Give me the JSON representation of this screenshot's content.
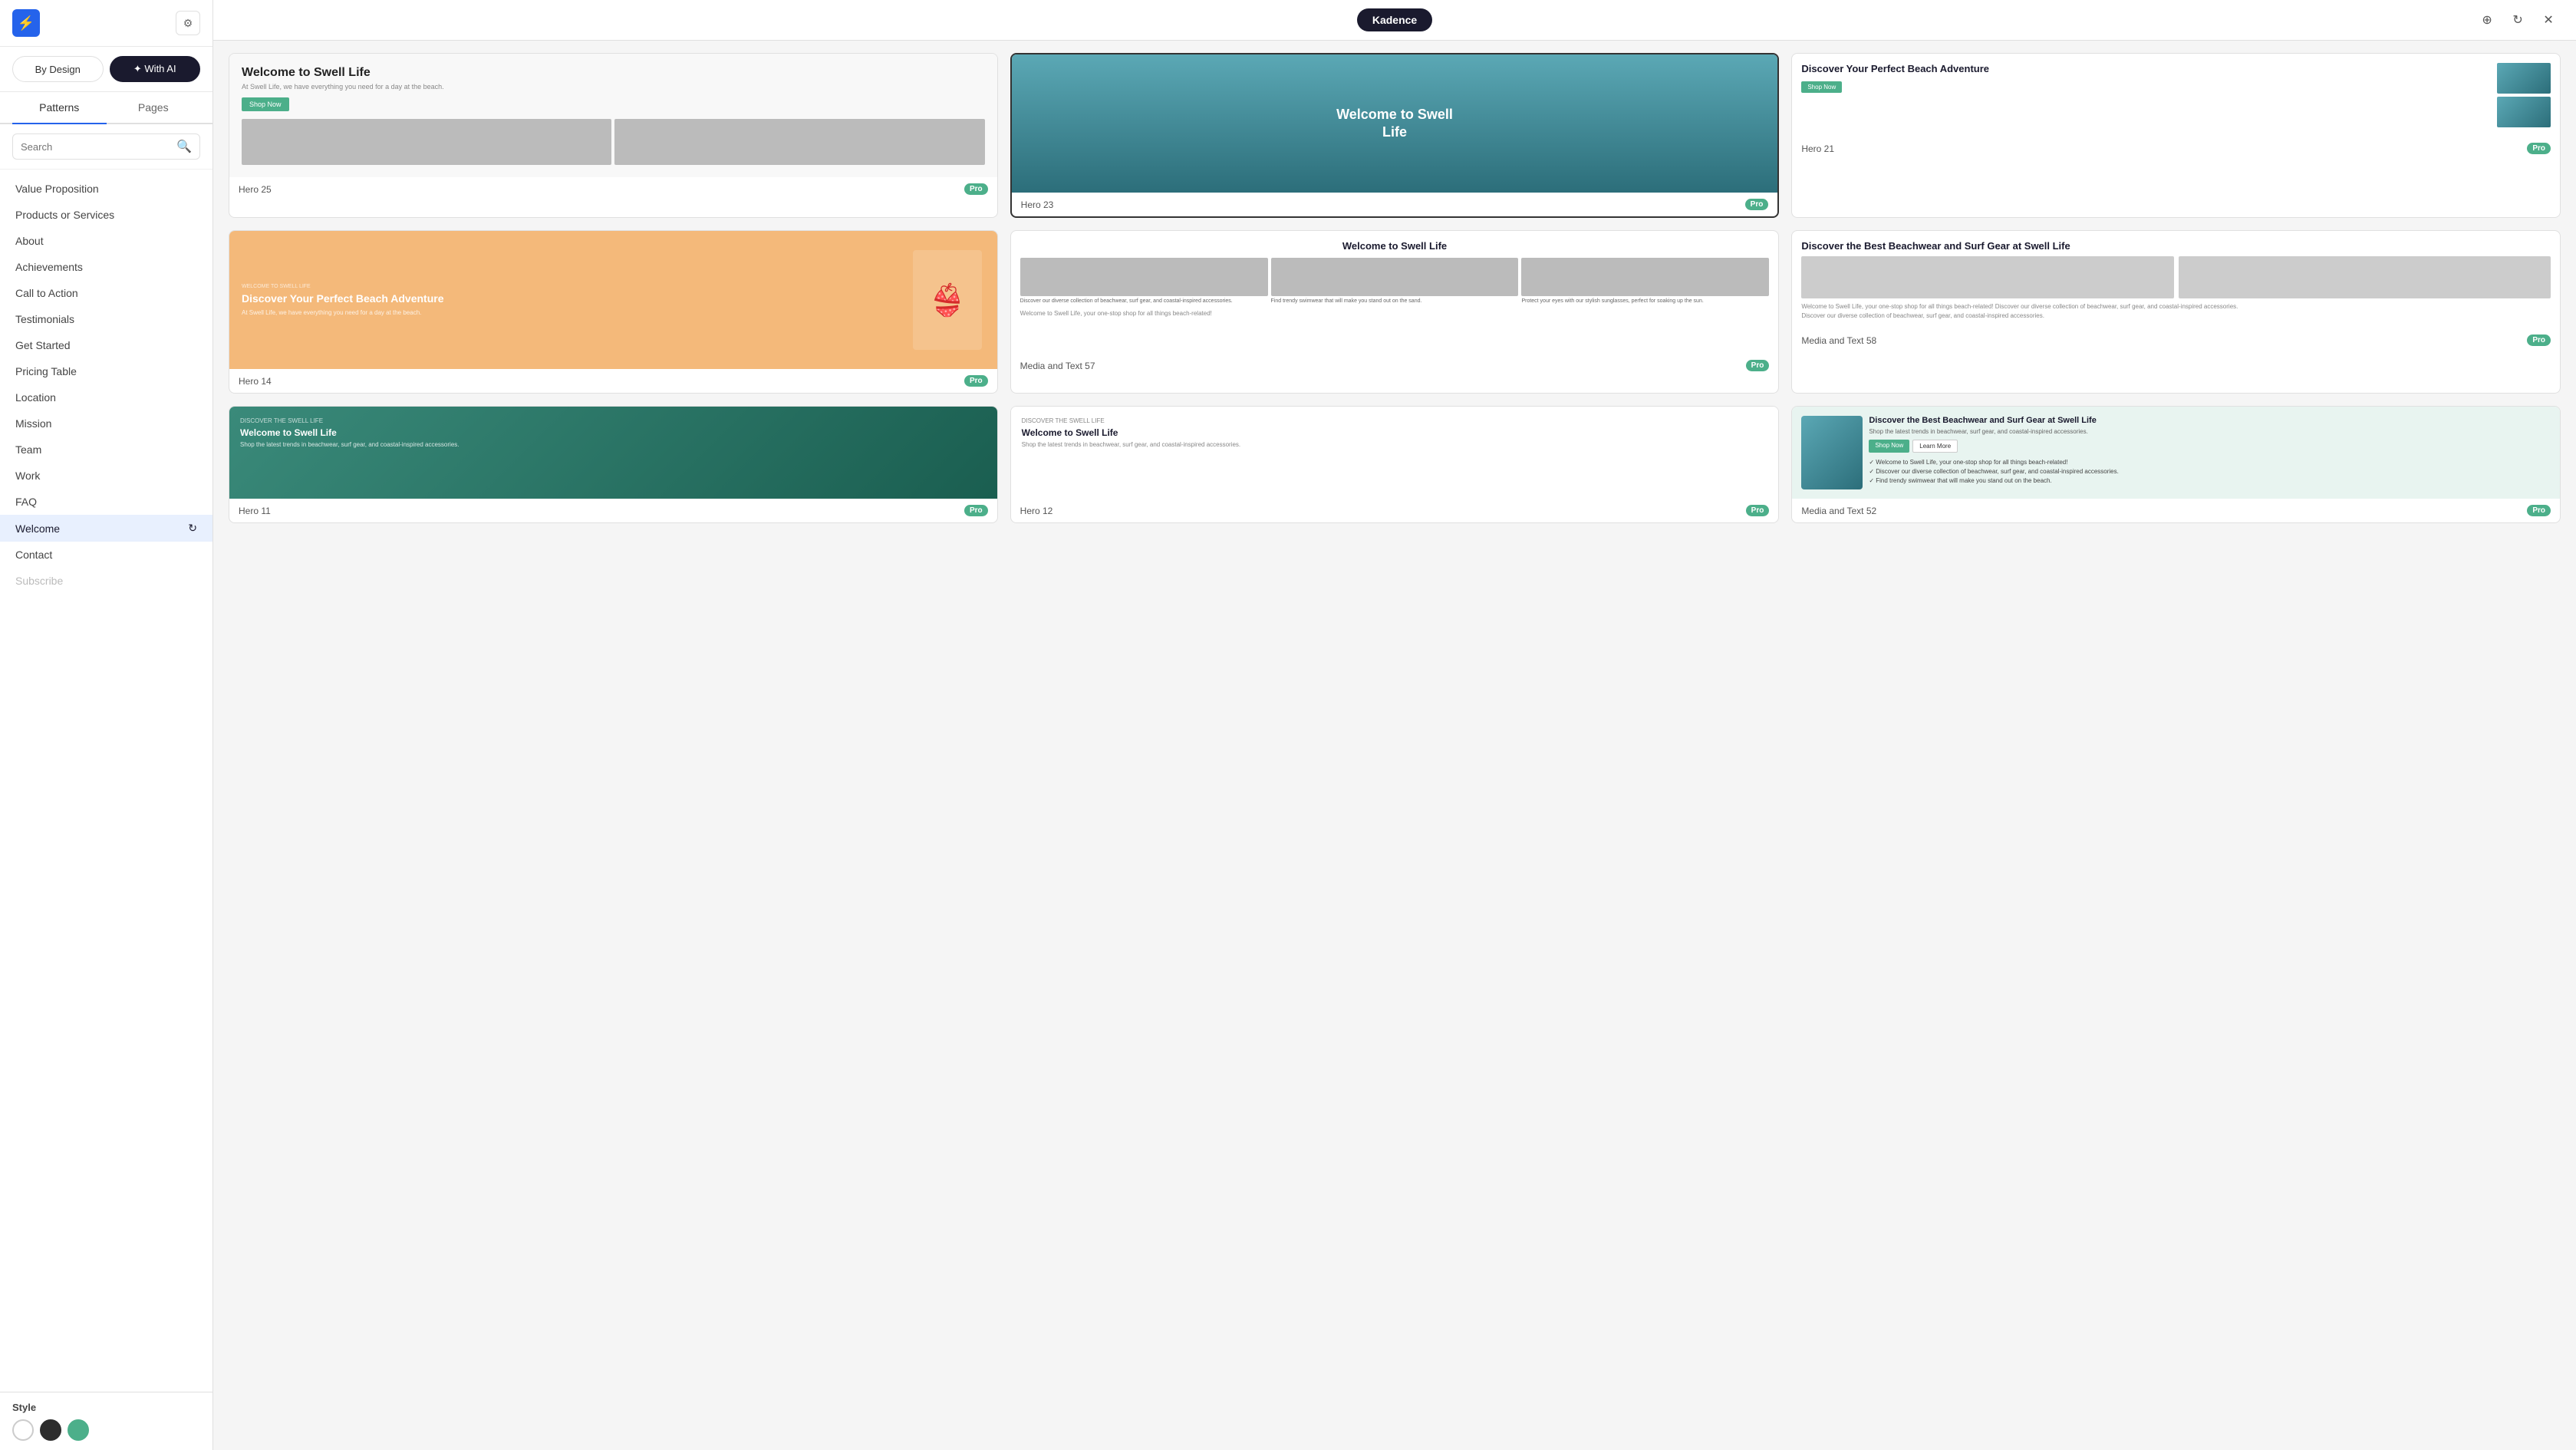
{
  "app": {
    "title": "Kadence",
    "logo_symbol": "⚡"
  },
  "sidebar": {
    "settings_icon": "⚙",
    "toggle": {
      "by_design_label": "By Design",
      "with_ai_label": "✦ With AI",
      "active": "with_ai"
    },
    "tabs": [
      {
        "id": "patterns",
        "label": "Patterns",
        "active": true
      },
      {
        "id": "pages",
        "label": "Pages",
        "active": false
      }
    ],
    "search": {
      "placeholder": "Search",
      "value": ""
    },
    "nav_items": [
      {
        "id": "value-proposition",
        "label": "Value Proposition",
        "active": false
      },
      {
        "id": "products-or-services",
        "label": "Products or Services",
        "active": false
      },
      {
        "id": "about",
        "label": "About",
        "active": false
      },
      {
        "id": "achievements",
        "label": "Achievements",
        "active": false
      },
      {
        "id": "call-to-action",
        "label": "Call to Action",
        "active": false
      },
      {
        "id": "testimonials",
        "label": "Testimonials",
        "active": false
      },
      {
        "id": "get-started",
        "label": "Get Started",
        "active": false
      },
      {
        "id": "pricing-table",
        "label": "Pricing Table",
        "active": false
      },
      {
        "id": "location",
        "label": "Location",
        "active": false
      },
      {
        "id": "mission",
        "label": "Mission",
        "active": false
      },
      {
        "id": "team",
        "label": "Team",
        "active": false
      },
      {
        "id": "work",
        "label": "Work",
        "active": false
      },
      {
        "id": "faq",
        "label": "FAQ",
        "active": false
      },
      {
        "id": "welcome",
        "label": "Welcome",
        "active": true
      },
      {
        "id": "contact",
        "label": "Contact",
        "active": false
      },
      {
        "id": "subscribe",
        "label": "Subscribe",
        "active": false
      }
    ],
    "style": {
      "label": "Style",
      "colors": [
        "#ffffff",
        "#2d2d2d",
        "#4caf8a"
      ]
    }
  },
  "topbar": {
    "brand": "Kadence",
    "add_icon": "⊕",
    "refresh_icon": "↻",
    "close_icon": "✕"
  },
  "cards": [
    {
      "id": "hero25",
      "label": "Hero 25",
      "badge": "Pro",
      "title": "Welcome to Swell Life",
      "subtitle": "At Swell Life, we have everything you need for a day at the beach.",
      "btn": "Shop Now",
      "col": 0
    },
    {
      "id": "hero23",
      "label": "Hero 23",
      "badge": "Pro",
      "title": "Welcome to Swell Life",
      "featured": true,
      "col": 1
    },
    {
      "id": "hero21",
      "label": "Hero 21",
      "badge": "Pro",
      "title": "Discover Your Perfect Beach Adventure",
      "btn": "Shop Now",
      "col": 2
    },
    {
      "id": "hero14",
      "label": "Hero 14",
      "badge": "Pro",
      "title": "Discover Your Perfect Beach Adventure",
      "subtitle": "At Swell Life, we have everything you need for a day at the beach.",
      "col": 0
    },
    {
      "id": "media57",
      "label": "Media and Text 57",
      "badge": "Pro",
      "title": "Welcome to Swell Life",
      "sub": "Welcome to Swell Life, your one-stop shop for all things beach-related!",
      "col": 1
    },
    {
      "id": "media58",
      "label": "Media and Text 58",
      "badge": "Pro",
      "title": "Discover the Best Beachwear and Surf Gear at Swell Life",
      "col": 2
    },
    {
      "id": "hero_bottom1",
      "label": "Hero 11",
      "badge": "Pro",
      "title": "Welcome to Swell Life",
      "col": 0
    },
    {
      "id": "hero_bottom2",
      "label": "Hero 12",
      "badge": "Pro",
      "title": "Welcome to Swell Life",
      "col": 1
    },
    {
      "id": "media52",
      "label": "Media and Text 52",
      "badge": "Pro",
      "title": "Discover the Best Beachwear and Surf Gear at Swell Life",
      "col": 2
    }
  ]
}
